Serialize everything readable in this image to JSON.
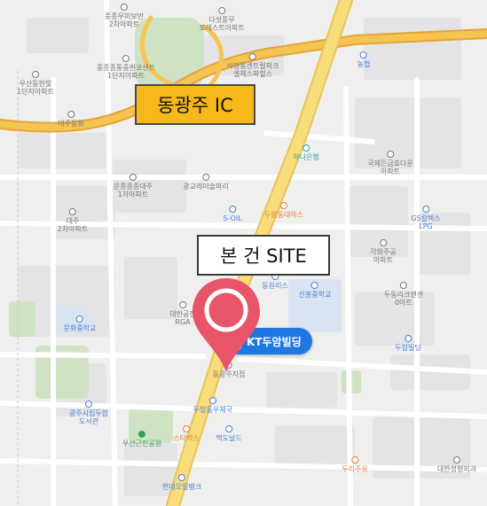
{
  "labels": {
    "ic": "동광주 IC",
    "site": "본 건 SITE",
    "kt": "KT두암빌딩"
  },
  "pois": [
    {
      "name": "poi-a",
      "text": "풍종우미보반\n2차아파트",
      "style": "gray"
    },
    {
      "name": "poi-b",
      "text": "다섯풍무\n포레스트아파트",
      "style": "gray"
    },
    {
      "name": "poi-c",
      "text": "풍종종통중흰코센트\n1단지아파트",
      "style": "gray"
    },
    {
      "name": "poi-d",
      "text": "삭정동센트럴파크\n엘체스파힐스",
      "style": "gray"
    },
    {
      "name": "poi-e",
      "text": "농협",
      "style": "blue"
    },
    {
      "name": "poi-f",
      "text": "문종종종대주\n1차아파트",
      "style": "gray"
    },
    {
      "name": "poi-g",
      "text": "광교레미솔파리",
      "style": "gray"
    },
    {
      "name": "poi-h",
      "text": "하나은행",
      "style": "teal"
    },
    {
      "name": "poi-i",
      "text": "국제든금호다운\n아파트",
      "style": "gray"
    },
    {
      "name": "poi-j",
      "text": "대주\n2차아파트",
      "style": "gray"
    },
    {
      "name": "poi-k",
      "text": "S-OIL",
      "style": "blue"
    },
    {
      "name": "poi-l",
      "text": "두암동대하스",
      "style": "orange"
    },
    {
      "name": "poi-m",
      "text": "GS칼텍스\nLPG",
      "style": "blue"
    },
    {
      "name": "poi-n",
      "text": "각화주공\n아파트",
      "style": "gray"
    },
    {
      "name": "poi-o",
      "text": "동원리스",
      "style": "blue"
    },
    {
      "name": "poi-p",
      "text": "신흥중학교",
      "style": "blue"
    },
    {
      "name": "poi-q",
      "text": "두동리크엔센\n0아트",
      "style": "gray"
    },
    {
      "name": "poi-r",
      "text": "대한공전\nRGA",
      "style": "gray"
    },
    {
      "name": "poi-s",
      "text": "문화중학교",
      "style": "blue"
    },
    {
      "name": "poi-t",
      "text": "두암빌딩",
      "style": "blue"
    },
    {
      "name": "poi-u",
      "text": "동광주지점",
      "style": "gray"
    },
    {
      "name": "poi-v",
      "text": "두암동우체국",
      "style": "blue"
    },
    {
      "name": "poi-w",
      "text": "광주시립두암\n도서관",
      "style": "blue"
    },
    {
      "name": "poi-x",
      "text": "우산근린공원",
      "style": "green"
    },
    {
      "name": "poi-y",
      "text": "스타벅스",
      "style": "orange"
    },
    {
      "name": "poi-z",
      "text": "맥도날드",
      "style": "blue"
    },
    {
      "name": "poi-aa",
      "text": "두리주유",
      "style": "orange"
    },
    {
      "name": "poi-ab",
      "text": "현대오일뱅크",
      "style": "blue"
    },
    {
      "name": "poi-ac",
      "text": "대한정형외과",
      "style": "gray"
    },
    {
      "name": "poi-ad",
      "text": "대주동화",
      "style": "gray"
    },
    {
      "name": "poi-ae",
      "text": "우산동한빛\n1단지아파트",
      "style": "gray"
    }
  ]
}
